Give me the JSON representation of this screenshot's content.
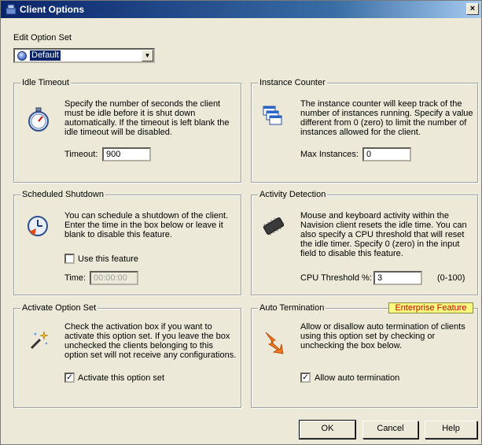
{
  "window": {
    "title": "Client Options"
  },
  "edit_option_set": {
    "label": "Edit Option Set",
    "selected": "Default"
  },
  "idle_timeout": {
    "title": "Idle Timeout",
    "description": "Specify the number of seconds the client must be idle before it is shut down automatically. If the timeout is left blank the idle timeout will be disabled.",
    "field_label": "Timeout:",
    "value": "900",
    "icon": "stopwatch-icon"
  },
  "instance_counter": {
    "title": "Instance Counter",
    "description": "The instance counter will keep track of the number of instances running. Specify a value different from 0 (zero) to limit the number of instances allowed for the client.",
    "field_label": "Max Instances:",
    "value": "0",
    "icon": "windows-stack-icon"
  },
  "scheduled_shutdown": {
    "title": "Scheduled Shutdown",
    "description": "You can schedule a shutdown of the client. Enter the time in the box below or leave it blank to disable this feature.",
    "checkbox_label": "Use this feature",
    "checked": false,
    "field_label": "Time:",
    "value": "00:00:00",
    "icon": "clock-shutdown-icon"
  },
  "activity_detection": {
    "title": "Activity Detection",
    "description": "Mouse and keyboard activity within the Navision client resets the idle time. You can also specify a CPU threshold that will reset the idle timer. Specify 0 (zero) in the input field to disable this feature.",
    "field_label": "CPU Threshold %:",
    "value": "3",
    "range": "(0-100)",
    "icon": "cpu-chip-icon"
  },
  "activate_option_set": {
    "title": "Activate Option Set",
    "description": "Check the activation box if you want to activate this option set. If you leave the box unchecked the clients belonging to this option set will not receive any configurations.",
    "checkbox_label": "Activate this option set",
    "checked": true,
    "icon": "magic-wand-icon"
  },
  "auto_termination": {
    "title": "Auto Termination",
    "badge": "Enterprise Feature",
    "description": "Allow or disallow auto termination of clients using this option set by checking or unchecking the box below.",
    "checkbox_label": "Allow auto termination",
    "checked": true,
    "icon": "lightning-arrow-icon"
  },
  "buttons": {
    "ok": "OK",
    "cancel": "Cancel",
    "help": "Help"
  }
}
